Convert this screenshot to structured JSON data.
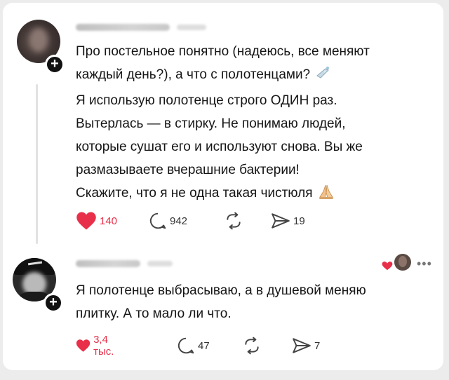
{
  "comments": [
    {
      "text_lines": [
        "Про постельное понятно (надеюсь, все меняют",
        "каждый день?), а что с полотенцами?"
      ],
      "text_lines_2": [
        "Я использую полотенце строго ОДИН раз.",
        "Вытерлась — в стирку. Не понимаю людей,",
        "которые сушат его и используют снова. Вы же",
        "размазываете вчерашние бактерии!",
        "Скажите, что я не одна такая чистюля"
      ],
      "likes": "140",
      "replies": "942",
      "shares": "19"
    },
    {
      "text_lines": [
        "Я полотенце выбрасываю, а в душевой меняю",
        "плитку. А то мало ли что."
      ],
      "likes": "3,4 тыс.",
      "replies": "47",
      "shares": "7"
    }
  ],
  "colors": {
    "like_red": "#e8304a",
    "icon_gray": "#444444"
  },
  "icons": [
    "heart-icon",
    "reply-icon",
    "repost-icon",
    "share-icon",
    "plus-icon",
    "soap-emoji",
    "praying-hands-emoji",
    "more-icon"
  ]
}
